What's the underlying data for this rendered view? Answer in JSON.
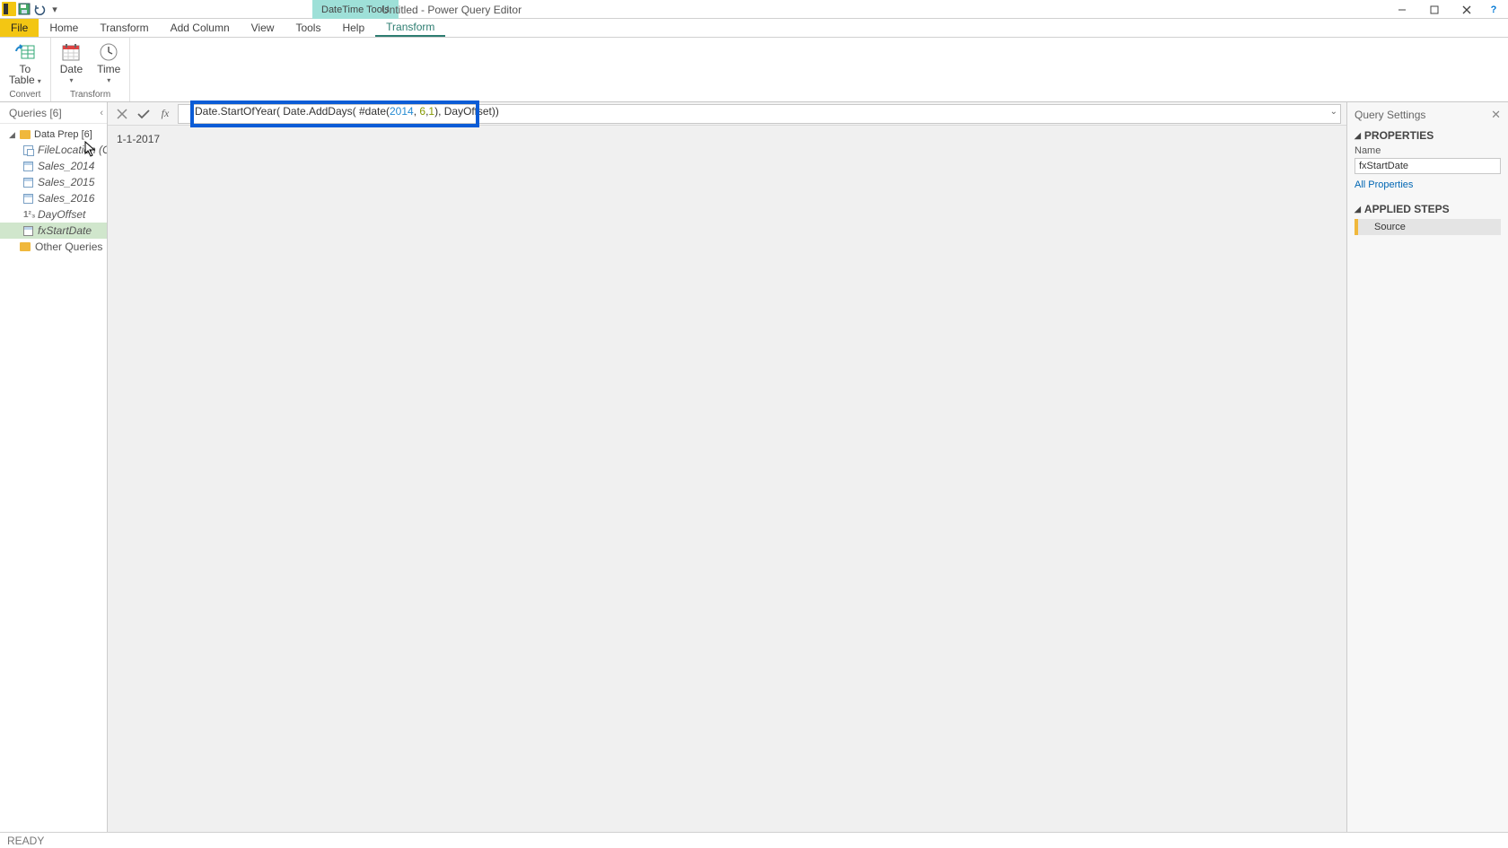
{
  "titlebar": {
    "context_tab": "DateTime Tools",
    "title": "Untitled - Power Query Editor"
  },
  "menu": {
    "file": "File",
    "home": "Home",
    "transform": "Transform",
    "add_column": "Add Column",
    "view": "View",
    "tools": "Tools",
    "help": "Help",
    "context_transform": "Transform"
  },
  "ribbon": {
    "group_convert": "Convert",
    "group_transform": "Transform",
    "to_table": "To\nTable",
    "date": "Date",
    "time": "Time"
  },
  "queries": {
    "header": "Queries [6]",
    "group": "Data Prep [6]",
    "items": [
      "FileLocation (C:\\...",
      "Sales_2014",
      "Sales_2015",
      "Sales_2016",
      "DayOffset",
      "fxStartDate"
    ],
    "other": "Other Queries"
  },
  "formula": {
    "text_prefix": "Date.StartOfYear( Date.AddDays( #date(",
    "num1": "2014",
    "sep1": ", ",
    "num2": "6",
    "sep2": ",",
    "num3": "1",
    "text_suffix": "), DayOffset))"
  },
  "preview": {
    "value": "1-1-2017"
  },
  "settings": {
    "title": "Query Settings",
    "properties": "PROPERTIES",
    "name_label": "Name",
    "name_value": "fxStartDate",
    "all_properties": "All Properties",
    "applied_steps": "APPLIED STEPS",
    "steps": [
      "Source"
    ]
  },
  "status": "READY"
}
